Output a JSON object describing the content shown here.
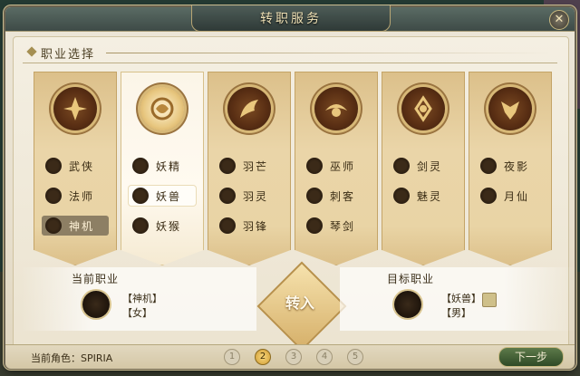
{
  "window": {
    "title": "转职服务"
  },
  "section": {
    "title": "职业选择"
  },
  "classes": [
    {
      "emblem": "warrior-emblem-icon",
      "options": [
        {
          "label": "武侠"
        },
        {
          "label": "法师"
        },
        {
          "label": "神机",
          "state": "selected-current"
        }
      ]
    },
    {
      "emblem": "fox-emblem-icon",
      "selected": true,
      "options": [
        {
          "label": "妖精"
        },
        {
          "label": "妖兽",
          "state": "selected-target"
        },
        {
          "label": "妖猴"
        }
      ]
    },
    {
      "emblem": "feather-emblem-icon",
      "options": [
        {
          "label": "羽芒"
        },
        {
          "label": "羽灵"
        },
        {
          "label": "羽锋"
        }
      ]
    },
    {
      "emblem": "bird-emblem-icon",
      "options": [
        {
          "label": "巫师"
        },
        {
          "label": "刺客"
        },
        {
          "label": "琴剑"
        }
      ]
    },
    {
      "emblem": "spirit-emblem-icon",
      "options": [
        {
          "label": "剑灵"
        },
        {
          "label": "魅灵"
        }
      ]
    },
    {
      "emblem": "dragon-emblem-icon",
      "options": [
        {
          "label": "夜影"
        },
        {
          "label": "月仙"
        }
      ]
    }
  ],
  "current": {
    "title": "当前职业",
    "class": "【神机】",
    "gender": "【女】"
  },
  "target": {
    "title": "目标职业",
    "class": "【妖兽】",
    "gender": "【男】"
  },
  "transfer_button": {
    "label": "转入"
  },
  "footer": {
    "role": "当前角色：SPIRIA",
    "steps": [
      {
        "label": "1"
      },
      {
        "label": "2",
        "active": true
      },
      {
        "label": "3"
      },
      {
        "label": "4"
      },
      {
        "label": "5"
      }
    ],
    "next": "下一步"
  },
  "colors": {
    "accent_gold": "#d7b877",
    "panel": "#ece6d8",
    "next_green": "#3f5d34"
  }
}
